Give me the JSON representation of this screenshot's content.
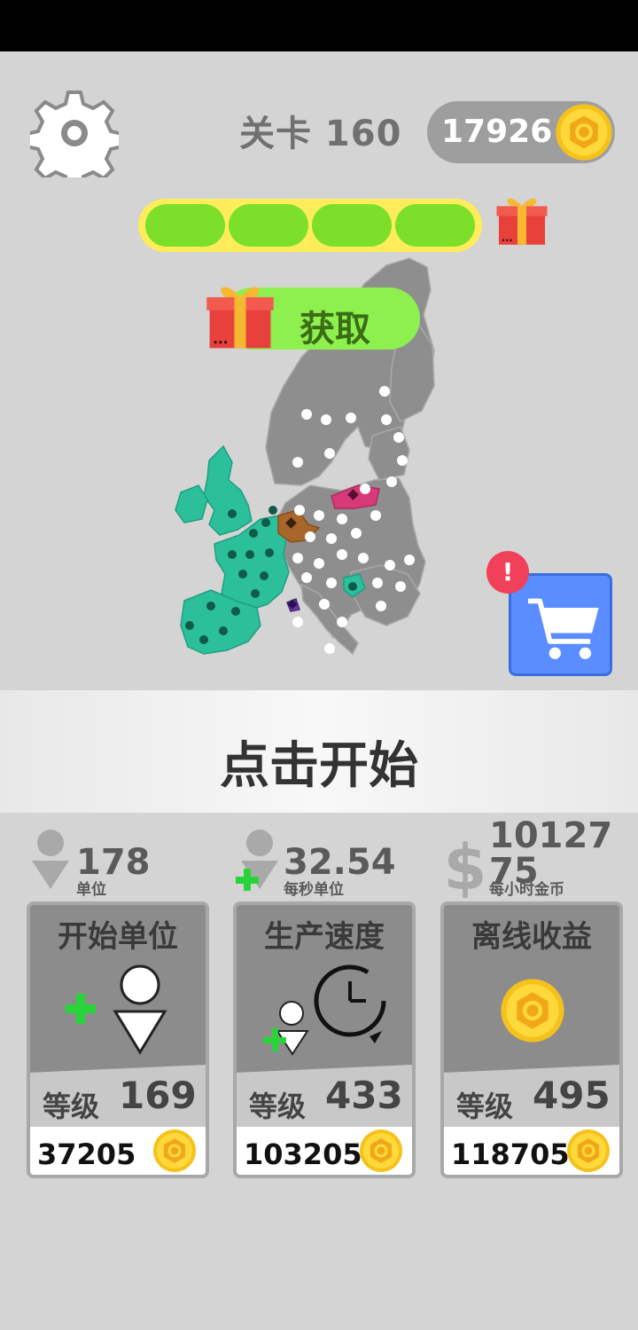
{
  "hud": {
    "level_label": "关卡 160",
    "coins": "17926",
    "progress_segments": 4,
    "claim_button": "获取",
    "shop_alert": "!"
  },
  "start": {
    "label": "点击开始"
  },
  "stats": [
    {
      "value": "178",
      "label": "单位",
      "icon": "unit-icon"
    },
    {
      "value": "32.54",
      "label": "每秒单位",
      "icon": "unit-plus-icon"
    },
    {
      "value": "1012775",
      "label": "每小时金币",
      "icon": "dollar-icon"
    }
  ],
  "upgrades": [
    {
      "title": "开始单位",
      "level_label": "等级",
      "level": "169",
      "price": "37205",
      "icon": "add-unit-icon"
    },
    {
      "title": "生产速度",
      "level_label": "等级",
      "level": "433",
      "price": "103205",
      "icon": "speed-clock-icon"
    },
    {
      "title": "离线收益",
      "level_label": "等级",
      "level": "495",
      "price": "118705",
      "icon": "coin-icon"
    }
  ],
  "colors": {
    "background": "#d4d4d4",
    "progress_fill": "#7ce02a",
    "progress_track": "#ffec5a",
    "claim_button": "#8ef04e",
    "player_territory": "#2bbf9a",
    "enemy_territory": "#888888",
    "shop_button": "#5a8dff",
    "alert_badge": "#f0405a",
    "coin": "#f5c21b"
  }
}
